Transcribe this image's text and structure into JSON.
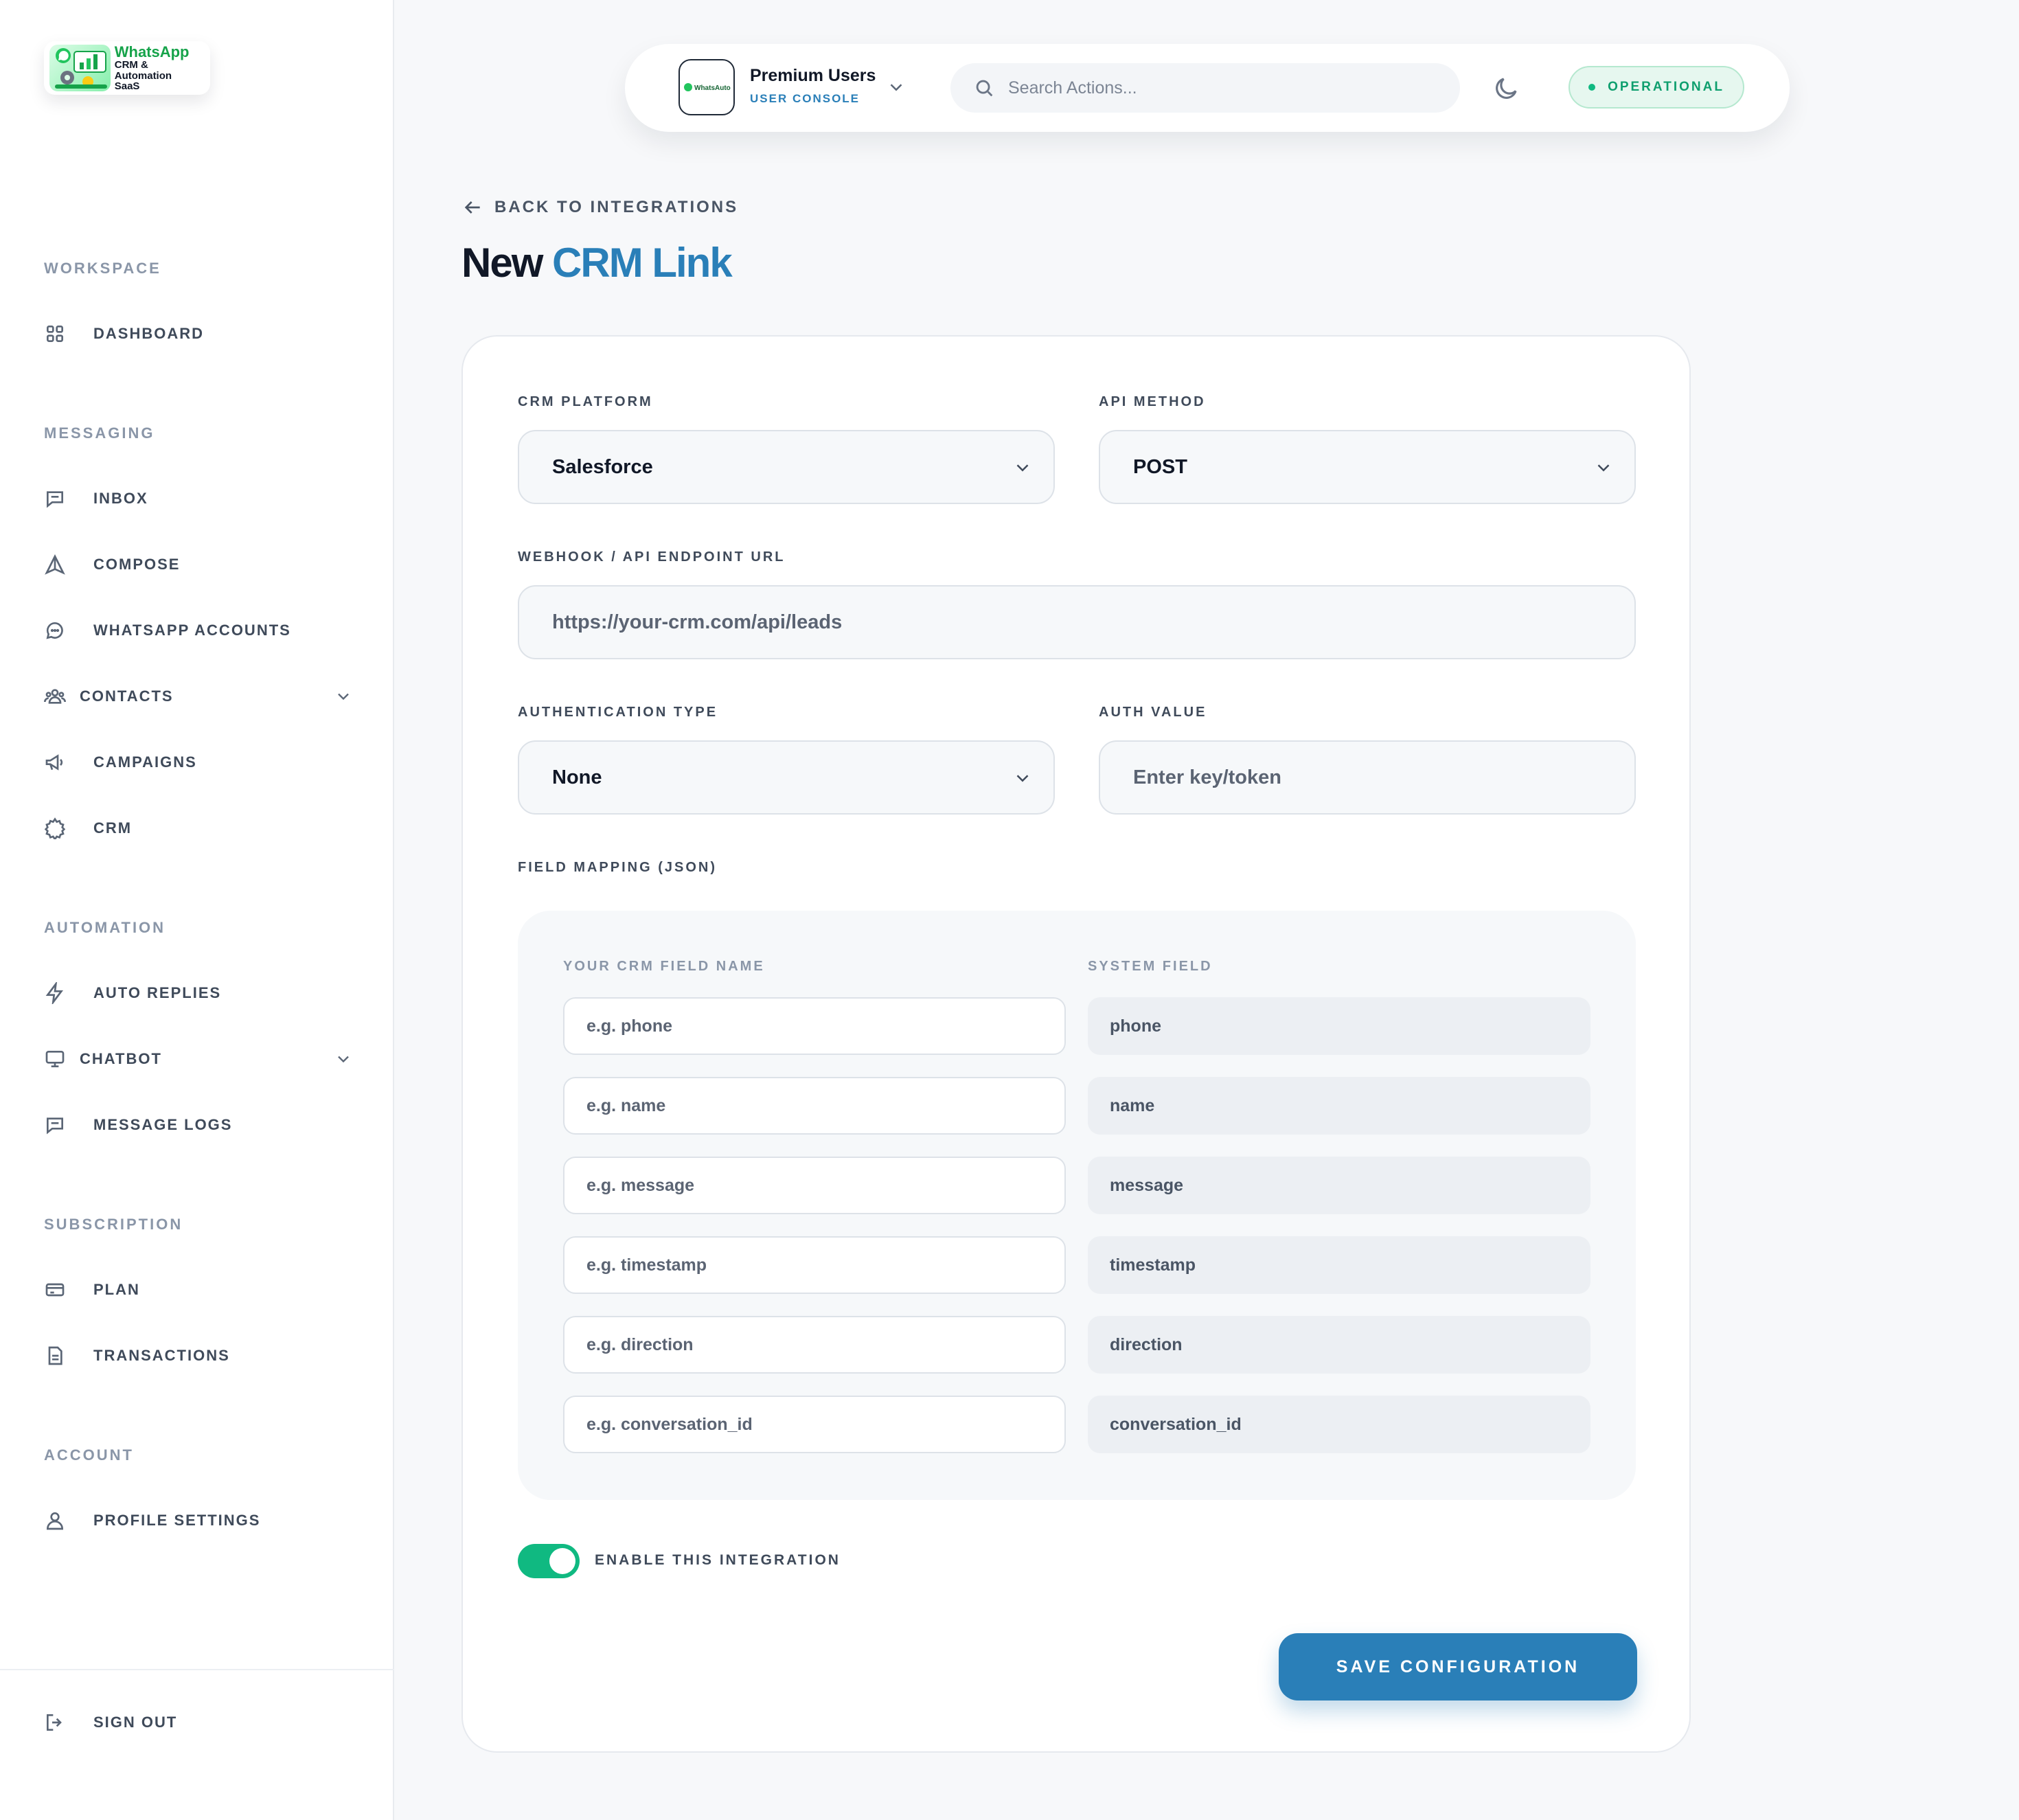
{
  "brand": {
    "logo_line1": "WhatsApp",
    "logo_line2": "CRM & Automation",
    "logo_line3": "SaaS"
  },
  "sidebar": {
    "sections": [
      {
        "title": "WORKSPACE",
        "items": [
          {
            "label": "DASHBOARD",
            "icon": "grid-icon"
          }
        ]
      },
      {
        "title": "MESSAGING",
        "items": [
          {
            "label": "INBOX",
            "icon": "chat-square-icon"
          },
          {
            "label": "COMPOSE",
            "icon": "send-icon"
          },
          {
            "label": "WHATSAPP ACCOUNTS",
            "icon": "chat-bubble-icon"
          },
          {
            "label": "CONTACTS",
            "icon": "users-icon",
            "expandable": true
          },
          {
            "label": "CAMPAIGNS",
            "icon": "megaphone-icon"
          },
          {
            "label": "CRM",
            "icon": "gear-icon"
          }
        ]
      },
      {
        "title": "AUTOMATION",
        "items": [
          {
            "label": "AUTO REPLIES",
            "icon": "bolt-icon"
          },
          {
            "label": "CHATBOT",
            "icon": "monitor-icon",
            "expandable": true
          },
          {
            "label": "MESSAGE LOGS",
            "icon": "chat-square-icon"
          }
        ]
      },
      {
        "title": "SUBSCRIPTION",
        "items": [
          {
            "label": "PLAN",
            "icon": "card-icon"
          },
          {
            "label": "TRANSACTIONS",
            "icon": "document-icon"
          }
        ]
      },
      {
        "title": "ACCOUNT",
        "items": [
          {
            "label": "PROFILE SETTINGS",
            "icon": "user-icon"
          }
        ]
      }
    ],
    "sign_out": "SIGN OUT"
  },
  "topbar": {
    "org_name": "Premium Users",
    "org_subtitle": "USER CONSOLE",
    "org_logo_text": "WhatsAuto",
    "search_placeholder": "Search Actions...",
    "status": "OPERATIONAL",
    "status_color": "#10b981"
  },
  "page": {
    "back_label": "BACK TO INTEGRATIONS",
    "title_plain": "New",
    "title_accent": "CRM Link",
    "accent_color": "#2a7fb8"
  },
  "form": {
    "crm_platform_label": "CRM PLATFORM",
    "crm_platform_value": "Salesforce",
    "api_method_label": "API METHOD",
    "api_method_value": "POST",
    "endpoint_label": "WEBHOOK / API ENDPOINT URL",
    "endpoint_placeholder": "https://your-crm.com/api/leads",
    "auth_type_label": "AUTHENTICATION TYPE",
    "auth_type_value": "None",
    "auth_value_label": "AUTH VALUE",
    "auth_value_placeholder": "Enter key/token",
    "mapping_label": "FIELD MAPPING (JSON)",
    "mapping_col1": "YOUR CRM FIELD NAME",
    "mapping_col2": "SYSTEM FIELD",
    "mappings": [
      {
        "placeholder": "e.g. phone",
        "system": "phone"
      },
      {
        "placeholder": "e.g. name",
        "system": "name"
      },
      {
        "placeholder": "e.g. message",
        "system": "message"
      },
      {
        "placeholder": "e.g. timestamp",
        "system": "timestamp"
      },
      {
        "placeholder": "e.g. direction",
        "system": "direction"
      },
      {
        "placeholder": "e.g. conversation_id",
        "system": "conversation_id"
      }
    ],
    "enable_label": "ENABLE THIS INTEGRATION",
    "enabled": true,
    "save_label": "SAVE CONFIGURATION"
  }
}
